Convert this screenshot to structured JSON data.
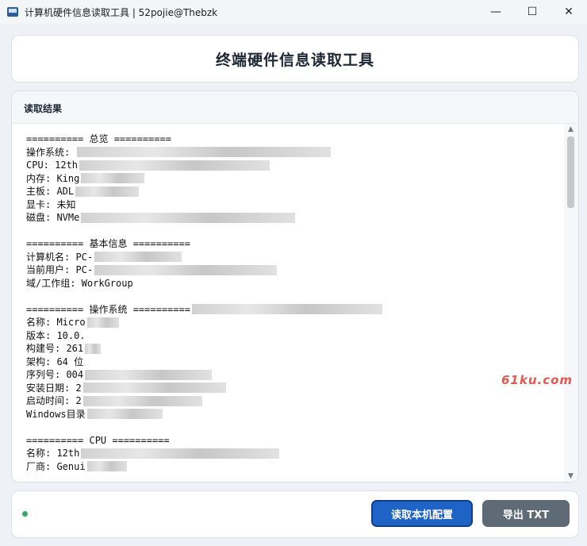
{
  "window": {
    "title": "计算机硬件信息读取工具 | 52pojie@Thebzk",
    "controls": [
      "—",
      "☐",
      "✕"
    ]
  },
  "header": {
    "title": "终端硬件信息读取工具"
  },
  "result": {
    "label": "读取结果",
    "lines": [
      "========== 总览 ==========",
      "操作系统: ",
      "CPU: 12th",
      "内存: King",
      "主板: ADL",
      "显卡: 未知",
      "磁盘: NVMe",
      "",
      "========== 基本信息 ==========",
      "计算机名: PC-",
      "当前用户: PC-",
      "域/工作组: WorkGroup",
      "",
      "========== 操作系统 ==========",
      "名称: Micro",
      "版本: 10.0.",
      "构建号: 261",
      "架构: 64 位",
      "序列号: 004",
      "安装日期: 2",
      "启动时间: 2",
      "Windows目录",
      "",
      "========== CPU ==========",
      "名称: 12th",
      "厂商: Genui"
    ]
  },
  "watermark": "61ku.com",
  "footer": {
    "read_button": "读取本机配置",
    "export_button": "导出 TXT"
  },
  "colors": {
    "primary": "#1f63c6",
    "secondary": "#5e6a76",
    "status_ok": "#3aa76d"
  }
}
